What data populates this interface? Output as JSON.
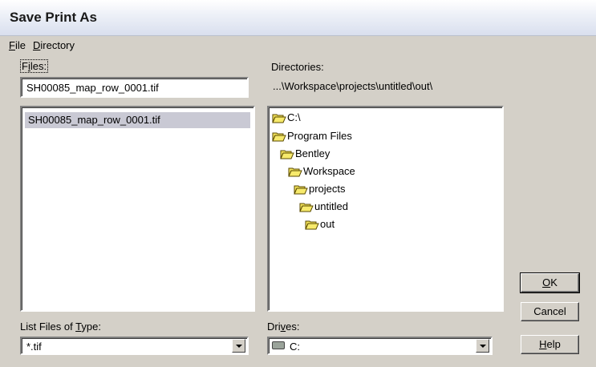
{
  "window": {
    "title": "Save Print As"
  },
  "menu": {
    "file": {
      "accel": "F",
      "rest": "ile"
    },
    "directory": {
      "accel": "D",
      "rest": "irectory"
    }
  },
  "files": {
    "label_pre": "F",
    "label_accel": "i",
    "label_post": "les:",
    "filename_value": "SH00085_map_row_0001.tif",
    "list": [
      "SH00085_map_row_0001.tif"
    ]
  },
  "directories": {
    "label": "Directories:",
    "current_path": "...\\Workspace\\projects\\untitled\\out\\",
    "tree": [
      {
        "name": "C:\\",
        "level": 0
      },
      {
        "name": "Program Files",
        "level": 1
      },
      {
        "name": "Bentley",
        "level": 2
      },
      {
        "name": "Workspace",
        "level": 3
      },
      {
        "name": "projects",
        "level": 4
      },
      {
        "name": "untitled",
        "level": 5
      },
      {
        "name": "out",
        "level": 6
      }
    ]
  },
  "filetype": {
    "label_pre": "List Files of ",
    "label_accel": "T",
    "label_post": "ype:",
    "selected": "*.tif"
  },
  "drives": {
    "label_pre": "Dri",
    "label_accel": "v",
    "label_post": "es:",
    "selected": "C:"
  },
  "buttons": {
    "ok": {
      "accel": "O",
      "rest": "K"
    },
    "cancel": "Cancel",
    "help": {
      "accel": "H",
      "rest": "elp"
    }
  },
  "colors": {
    "folder_fill": "#f2e25a",
    "selection": "#c9c9d4"
  },
  "icons": {
    "folder": "folder-icon",
    "drive": "drive-icon",
    "dropdown": "chevron-down-icon"
  }
}
